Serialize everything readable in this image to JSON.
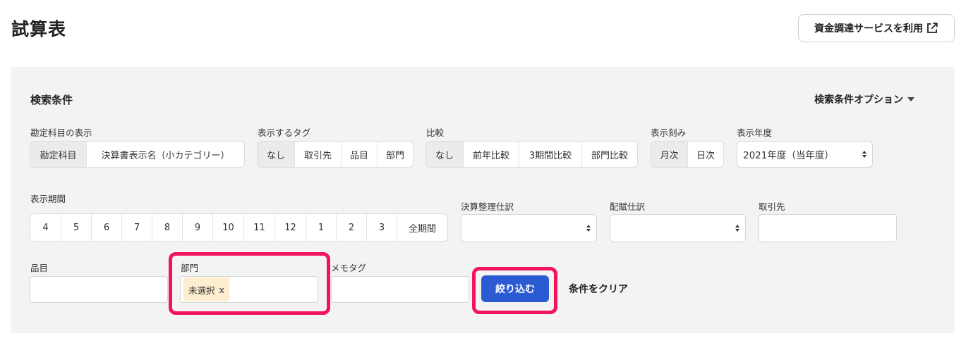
{
  "header": {
    "title": "試算表",
    "funding_button": "資金調達サービスを利用"
  },
  "search": {
    "section_title": "検索条件",
    "options_label": "検索条件オプション",
    "account_display": {
      "label": "勘定科目の表示",
      "options": [
        "勘定科目",
        "決算書表示名（小カテゴリー）"
      ],
      "selected": "勘定科目"
    },
    "tag_display": {
      "label": "表示するタグ",
      "options": [
        "なし",
        "取引先",
        "品目",
        "部門"
      ],
      "selected": "なし"
    },
    "comparison": {
      "label": "比較",
      "options": [
        "なし",
        "前年比較",
        "3期間比較",
        "部門比較"
      ],
      "selected": "なし"
    },
    "interval": {
      "label": "表示刻み",
      "options": [
        "月次",
        "日次"
      ],
      "selected": "月次"
    },
    "fiscal_year": {
      "label": "表示年度",
      "value": "2021年度（当年度）"
    },
    "period": {
      "label": "表示期間",
      "options": [
        "4",
        "5",
        "6",
        "7",
        "8",
        "9",
        "10",
        "11",
        "12",
        "1",
        "2",
        "3",
        "全期間"
      ]
    },
    "closing_entries": {
      "label": "決算整理仕訳",
      "value": ""
    },
    "allocation_entries": {
      "label": "配賦仕訳",
      "value": ""
    },
    "partner": {
      "label": "取引先",
      "value": ""
    },
    "item": {
      "label": "品目",
      "value": ""
    },
    "department": {
      "label": "部門",
      "chip": "未選択",
      "chip_remove": "x"
    },
    "memo_tag": {
      "label": "メモタグ",
      "value": ""
    },
    "filter_button": "絞り込む",
    "clear_link": "条件をクリア"
  },
  "colors": {
    "primary": "#2b5bd3",
    "highlight": "#f2145f",
    "chip_bg": "#fdeecf",
    "panel_bg": "#f3f3f3"
  }
}
